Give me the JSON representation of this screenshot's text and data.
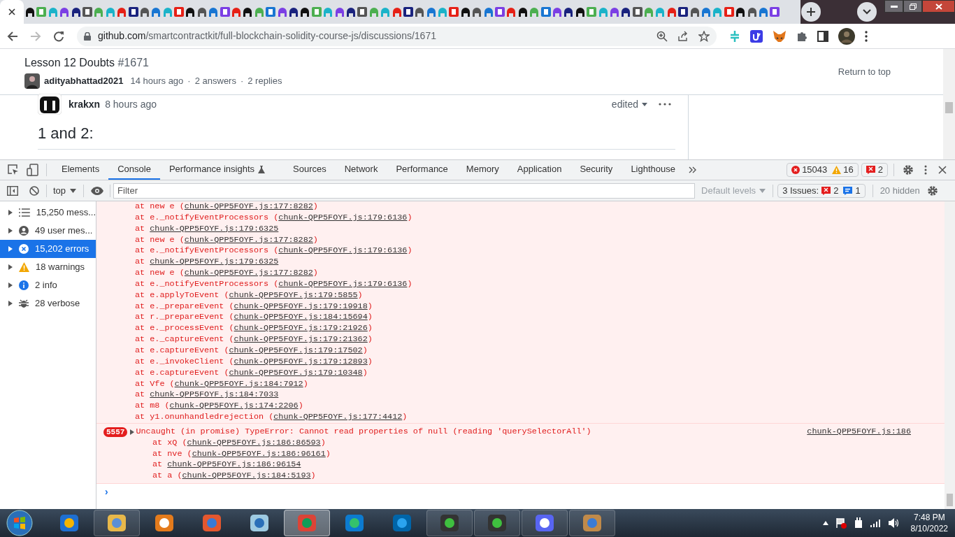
{
  "browser": {
    "address_host": "github.com",
    "address_path": "/smartcontractkit/full-blockchain-solidity-course-js/discussions/1671"
  },
  "page": {
    "title": "Lesson 12 Doubts",
    "number": "#1671",
    "author": "adityabhattad2021",
    "time": "14 hours ago",
    "separator_1": "·",
    "answers": "2 answers",
    "separator_2": "·",
    "replies": "2 replies",
    "return_link": "Return to top",
    "comment": {
      "author": "krakxn",
      "time": "8 hours ago",
      "edited": "edited",
      "heading": "1 and 2:"
    }
  },
  "devtools": {
    "tabs": [
      {
        "label": "Elements",
        "selected": false,
        "experimental": false
      },
      {
        "label": "Console",
        "selected": true,
        "experimental": false
      },
      {
        "label": "Performance insights",
        "selected": false,
        "experimental": true
      },
      {
        "label": "Sources",
        "selected": false,
        "experimental": false
      },
      {
        "label": "Network",
        "selected": false,
        "experimental": false
      },
      {
        "label": "Performance",
        "selected": false,
        "experimental": false
      },
      {
        "label": "Memory",
        "selected": false,
        "experimental": false
      },
      {
        "label": "Application",
        "selected": false,
        "experimental": false
      },
      {
        "label": "Security",
        "selected": false,
        "experimental": false
      },
      {
        "label": "Lighthouse",
        "selected": false,
        "experimental": false
      }
    ],
    "error_count": "15043",
    "warning_count": "16",
    "issue_count": "2",
    "context": "top",
    "filter_placeholder": "Filter",
    "levels": "Default levels",
    "issues_label": "3 Issues:",
    "issue_errors": "2",
    "issue_info": "1",
    "hidden": "20 hidden",
    "sidebar": [
      {
        "kind": "messages",
        "label": "15,250 mess...",
        "selected": false
      },
      {
        "kind": "user",
        "label": "49 user mes...",
        "selected": false
      },
      {
        "kind": "errors",
        "label": "15,202 errors",
        "selected": true
      },
      {
        "kind": "warnings",
        "label": "18 warnings",
        "selected": false
      },
      {
        "kind": "info",
        "label": "2 info",
        "selected": false
      },
      {
        "kind": "verbose",
        "label": "28 verbose",
        "selected": false
      }
    ],
    "trace": [
      {
        "before": "at new e (",
        "link": "chunk-QPP5FOYF.js:177:8282",
        "after": ")"
      },
      {
        "before": "at e._notifyEventProcessors (",
        "link": "chunk-QPP5FOYF.js:179:6136",
        "after": ")"
      },
      {
        "before": "at ",
        "link": "chunk-QPP5FOYF.js:179:6325"
      },
      {
        "before": "at new e (",
        "link": "chunk-QPP5FOYF.js:177:8282",
        "after": ")"
      },
      {
        "before": "at e._notifyEventProcessors (",
        "link": "chunk-QPP5FOYF.js:179:6136",
        "after": ")"
      },
      {
        "before": "at ",
        "link": "chunk-QPP5FOYF.js:179:6325"
      },
      {
        "before": "at new e (",
        "link": "chunk-QPP5FOYF.js:177:8282",
        "after": ")"
      },
      {
        "before": "at e._notifyEventProcessors (",
        "link": "chunk-QPP5FOYF.js:179:6136",
        "after": ")"
      },
      {
        "before": "at e.applyToEvent (",
        "link": "chunk-QPP5FOYF.js:179:5855",
        "after": ")"
      },
      {
        "before": "at e._prepareEvent (",
        "link": "chunk-QPP5FOYF.js:179:19918",
        "after": ")"
      },
      {
        "before": "at r._prepareEvent (",
        "link": "chunk-QPP5FOYF.js:184:15694",
        "after": ")"
      },
      {
        "before": "at e._processEvent (",
        "link": "chunk-QPP5FOYF.js:179:21926",
        "after": ")"
      },
      {
        "before": "at e._captureEvent (",
        "link": "chunk-QPP5FOYF.js:179:21362",
        "after": ")"
      },
      {
        "before": "at e.captureEvent (",
        "link": "chunk-QPP5FOYF.js:179:17502",
        "after": ")"
      },
      {
        "before": "at e._invokeClient (",
        "link": "chunk-QPP5FOYF.js:179:12893",
        "after": ")"
      },
      {
        "before": "at e.captureEvent (",
        "link": "chunk-QPP5FOYF.js:179:10348",
        "after": ")"
      },
      {
        "before": "at Vfe (",
        "link": "chunk-QPP5FOYF.js:184:7912",
        "after": ")"
      },
      {
        "before": "at ",
        "link": "chunk-QPP5FOYF.js:184:7033"
      },
      {
        "before": "at m8 (",
        "link": "chunk-QPP5FOYF.js:174:2206",
        "after": ")"
      },
      {
        "before": "at y1.onunhandledrejection (",
        "link": "chunk-QPP5FOYF.js:177:4412",
        "after": ")"
      }
    ],
    "error": {
      "badge": "5557",
      "message": "Uncaught (in promise) TypeError: Cannot read properties of null (reading 'querySelectorAll')",
      "source": "chunk-QPP5FOYF.js:186",
      "trace": [
        {
          "before": "at xQ (",
          "link": "chunk-QPP5FOYF.js:186:86593",
          "after": ")"
        },
        {
          "before": "at nve (",
          "link": "chunk-QPP5FOYF.js:186:96161",
          "after": ")"
        },
        {
          "before": "at ",
          "link": "chunk-QPP5FOYF.js:186:96154"
        },
        {
          "before": "at a (",
          "link": "chunk-QPP5FOYF.js:184:5193",
          "after": ")"
        }
      ]
    },
    "prompt": "›"
  },
  "taskbar": {
    "time": "7:48 PM",
    "date": "8/10/2022"
  }
}
